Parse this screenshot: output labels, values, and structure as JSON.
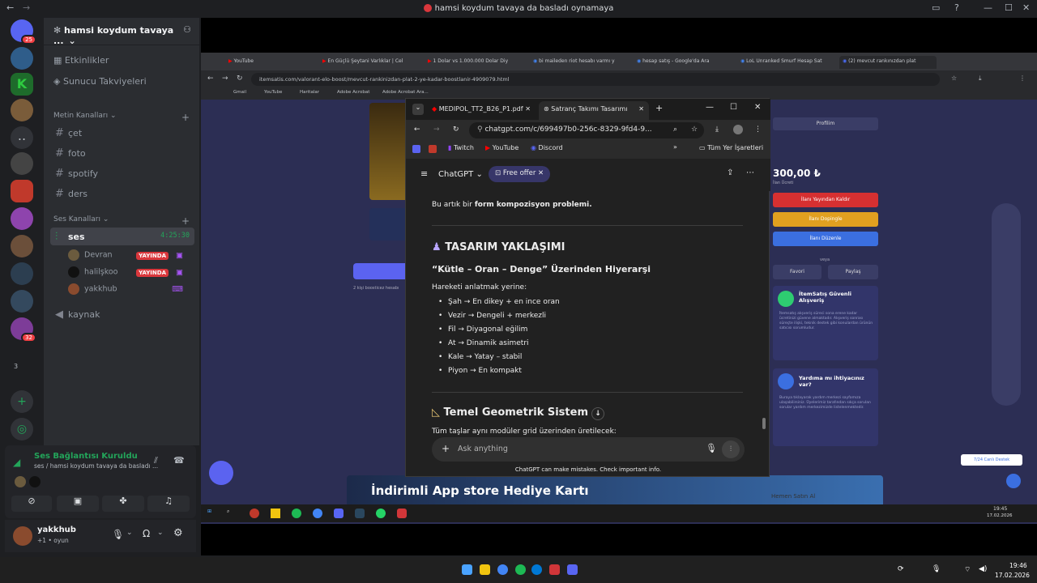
{
  "titlebar": {
    "title": "hamsi koydum tavaya da basladı oynamaya"
  },
  "guilds": {
    "badge_top": "25",
    "badge_bottom": "32",
    "folder_count": "3"
  },
  "server": {
    "name": "hamsi koydum tavaya ..."
  },
  "nav": {
    "events": "Etkinlikler",
    "boosts": "Sunucu Takviyeleri"
  },
  "text_category": "Metin Kanalları",
  "text_channels": [
    "çet",
    "foto",
    "spotify",
    "ders"
  ],
  "voice_category": "Ses Kanalları",
  "voice_channel": {
    "name": "ses",
    "timer": "4:25:30"
  },
  "voice_users": [
    {
      "name": "Devran",
      "live": "YAYINDA"
    },
    {
      "name": "halilşkoo",
      "live": "YAYINDA"
    },
    {
      "name": "yakkhub",
      "live": ""
    }
  ],
  "other_voice": "kaynak",
  "voice_panel": {
    "status": "Ses Bağlantısı Kuruldu",
    "detail": "ses / hamsi koydum tavaya da basladı ..."
  },
  "user_panel": {
    "name": "yakkhub",
    "status": "+1 • oyun"
  },
  "browser": {
    "tabs": [
      "YouTube",
      "En Güçlü Şeytani Varlıklar | Cel",
      "1 Dolar vs 1.000.000 Dolar Diy",
      "bi maileden riot hesabı varmı y",
      "hesap satış - Google'da Ara",
      "LoL Unranked Smurf Hesap Sat",
      "(2) mevcut rankınızdan plat"
    ],
    "url": "itemsatis.com/valorant-elo-boost/mevcut-rankinizdan-plat-2-ye-kadar-boostlanir-4909079.html",
    "bookmarks": [
      "Gmail",
      "YouTube",
      "Haritalar",
      "Adobe Acrobat",
      "Adobe Acrobat Ara..."
    ]
  },
  "site": {
    "profile_btn": "Profilim",
    "price": "300,00 ₺",
    "price_sub": "İlan Ücreti",
    "btn_remove": "İlanı Yayından Kaldır",
    "btn_doping": "İlanı Dopingle",
    "btn_edit": "İlanı Düzenle",
    "fav": "Favori",
    "share": "Paylaş",
    "or": "veya",
    "trust_title": "İtemSatış Güvenli Alışveriş",
    "trust_text": "İtemsatış alışveriş süreci sona erene kadar ücretinizi güvene almaktadır. Alışveriş sonrası süreçte ilişki, teknik destek gibi konulardan ürünün satıcısı sorumludur.",
    "help_title": "Yardıma mı ihtiyacınız var?",
    "help_text": "Buraya tıklayarak yardım merkezi sayfamıza ulaşabilirsiniz. Üyelerimiz tarafından sıkça sorulan sorular yardım merkezimizde listelenmektedir.",
    "support_chip": "7/24 Canlı Destek",
    "boost_note": "2 kişi boosticez hesabı",
    "banner": "İndirimli App store Hediye Kartı",
    "banner_btn": "Hemen Satın Al"
  },
  "chat_window": {
    "tabs": [
      "MEDIPOL_TT2_B26_P1.pdf",
      "Satranç Takımı Tasarımı"
    ],
    "url": "chatgpt.com/c/699497b0-256c-8329-9fd4-9...",
    "bookmarks": [
      "Twitch",
      "YouTube",
      "Discord"
    ],
    "all_bookmarks": "Tüm Yer İşaretleri",
    "model": "ChatGPT",
    "offer": "Free offer",
    "intro_pre": "Bu artık bir ",
    "intro_bold": "form kompozisyon problemi.",
    "h_approach": "TASARIM YAKLAŞIMI",
    "h_hierarchy": "“Kütle – Oran – Denge” Üzerinden Hiyerarşi",
    "lead": "Hareketi anlatmak yerine:",
    "items": [
      "Şah → En dikey + en ince oran",
      "Vezir → Dengeli + merkezli",
      "Fil → Diyagonal eğilim",
      "At → Dinamik asimetri",
      "Kale → Yatay – stabil",
      "Piyon → En kompakt"
    ],
    "h_geometry": "Temel Geometrik Sistem",
    "geometry_lead": "Tüm taşlar aynı modüler grid üzerinden üretilecek:",
    "composer_placeholder": "Ask anything",
    "disclaimer": "ChatGPT can make mistakes. Check important info."
  },
  "inner_taskbar": {
    "time": "19:45",
    "date": "17.02.2026"
  },
  "taskbar": {
    "time": "19:46",
    "date": "17.02.2026"
  },
  "colors": {
    "discord_bg": "#2b2d31",
    "live_red": "#da373c",
    "green": "#23a55a",
    "site_bg": "#2c2e54"
  }
}
